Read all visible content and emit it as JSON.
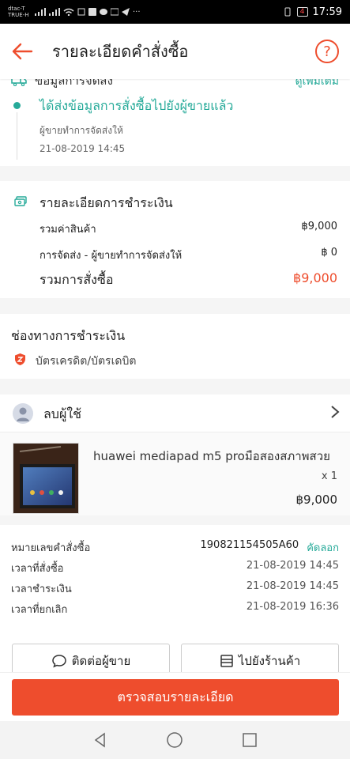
{
  "status_bar": {
    "carrier_1": "dtac-T",
    "carrier_2": "TRUE-H",
    "battery": "4",
    "time": "17:59"
  },
  "header": {
    "title": "รายละเอียดคำสั่งซื้อ",
    "help_label": "?"
  },
  "shipping": {
    "title": "ข้อมูลการจัดส่ง",
    "more_link": "ดูเพิ่มเติม",
    "status": "ได้ส่งข้อมูลการสั่งซื้อไปยังผู้ขายแล้ว",
    "note": "ผู้ขายทำการจัดส่งให้",
    "datetime": "21-08-2019 14:45"
  },
  "payment_summary": {
    "title": "รายละเอียดการชำระเงิน",
    "rows": [
      {
        "label": "รวมค่าสินค้า",
        "amount": "฿9,000"
      },
      {
        "label": "การจัดส่ง - ผู้ขายทำการจัดส่งให้",
        "amount": "฿ 0"
      }
    ],
    "total_label": "รวมการสั่งซื้อ",
    "total_amount": "฿9,000"
  },
  "payment_channel": {
    "title": "ช่องทางการชำระเงิน",
    "method": "บัตรเครดิต/บัตรเดบิต"
  },
  "seller": {
    "name": "ลบผู้ใช้"
  },
  "product": {
    "name": "huawei mediapad m5 proมือสองสภาพสวย",
    "quantity": "x 1",
    "price": "฿9,000"
  },
  "order_info": {
    "order_no_label": "หมายเลขคำสั่งซื้อ",
    "order_no": "190821154505A60",
    "copy_label": "คัดลอก",
    "rows": [
      {
        "label": "เวลาที่สั่งซื้อ",
        "value": "21-08-2019 14:45"
      },
      {
        "label": "เวลาชำระเงิน",
        "value": "21-08-2019 14:45"
      },
      {
        "label": "เวลาที่ยกเลิก",
        "value": "21-08-2019 16:36"
      }
    ]
  },
  "actions": {
    "contact_seller": "ติดต่อผู้ขาย",
    "go_to_shop": "ไปยังร้านค้า"
  },
  "cta": {
    "label": "ตรวจสอบรายละเอียด"
  },
  "colors": {
    "brand": "#ee4d2d",
    "teal": "#26aa99"
  }
}
